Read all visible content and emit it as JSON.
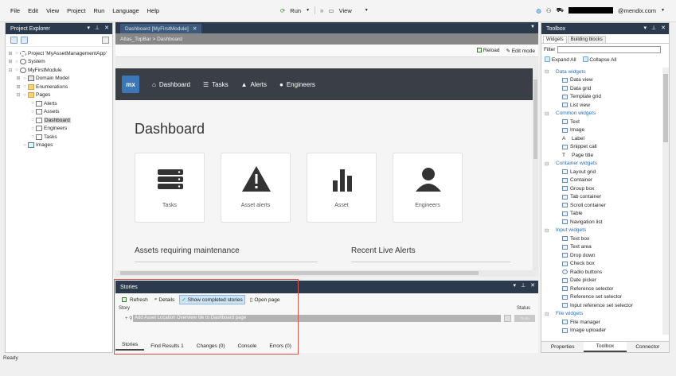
{
  "menubar": {
    "items": [
      "File",
      "Edit",
      "View",
      "Project",
      "Run",
      "Language",
      "Help"
    ],
    "run_label": "Run",
    "view_label": "View",
    "user_suffix": "@mendix.com"
  },
  "explorer": {
    "title": "Project Explorer",
    "tree": [
      {
        "label": "Project 'MyAssetManagementApp'",
        "level": 0,
        "icon": "gear-icon"
      },
      {
        "label": "System",
        "level": 0,
        "icon": "globe-icon"
      },
      {
        "label": "MyFirstModule",
        "level": 0,
        "icon": "globe-icon"
      },
      {
        "label": "Domain Model",
        "level": 1,
        "icon": "domain-model-icon"
      },
      {
        "label": "Enumerations",
        "level": 1,
        "icon": "folder-icon"
      },
      {
        "label": "Pages",
        "level": 1,
        "icon": "folder-icon"
      },
      {
        "label": "Alerts",
        "level": 2,
        "icon": "page-icon"
      },
      {
        "label": "Assets",
        "level": 2,
        "icon": "page-icon"
      },
      {
        "label": "Dashboard",
        "level": 2,
        "icon": "page-icon",
        "selected": true
      },
      {
        "label": "Engineers",
        "level": 2,
        "icon": "page-icon"
      },
      {
        "label": "Tasks",
        "level": 2,
        "icon": "page-icon"
      },
      {
        "label": "Images",
        "level": 1,
        "icon": "image-icon"
      }
    ]
  },
  "editor": {
    "tab_label": "Dashboard [MyFirstModule]",
    "breadcrumb": "Atlas_TopBar > Dashboard",
    "reload_label": "Reload",
    "edit_mode_label": "Edit mode",
    "logo": "mx",
    "nav": [
      "Dashboard",
      "Tasks",
      "Alerts",
      "Engineers"
    ],
    "page_title": "Dashboard",
    "tiles": [
      "Tasks",
      "Asset alerts",
      "Asset",
      "Engineers"
    ],
    "section_left": "Assets requiring maintenance",
    "section_right": "Recent Live Alerts"
  },
  "stories": {
    "title": "Stories",
    "toolbar": {
      "refresh": "Refresh",
      "details": "Details",
      "show_completed": "Show completed stories",
      "open_page": "Open page"
    },
    "col_story": "Story",
    "col_status": "Status",
    "rows": [
      {
        "text": "Add Asset Location Overview tile to Dashboard page",
        "status": "To-do"
      }
    ],
    "tabs": [
      "Stories",
      "Find Results 1",
      "Changes (0)",
      "Console",
      "Errors (0)"
    ]
  },
  "toolbox": {
    "title": "Toolbox",
    "tabs": [
      "Widgets",
      "Building blocks"
    ],
    "filter_label": "Filter",
    "filter_value": "",
    "expand_all": "Expand All",
    "collapse_all": "Collapse All",
    "categories": [
      {
        "name": "Data widgets",
        "items": [
          "Data view",
          "Data grid",
          "Template grid",
          "List view"
        ]
      },
      {
        "name": "Common widgets",
        "items": [
          "Text",
          "Image",
          "Label",
          "Snippet call",
          "Page title"
        ]
      },
      {
        "name": "Container widgets",
        "items": [
          "Layout grid",
          "Container",
          "Group box",
          "Tab container",
          "Scroll container",
          "Table",
          "Navigation list"
        ]
      },
      {
        "name": "Input widgets",
        "items": [
          "Text box",
          "Text area",
          "Drop down",
          "Check box",
          "Radio buttons",
          "Date picker",
          "Reference selector",
          "Reference set selector",
          "Input reference set selector"
        ]
      },
      {
        "name": "File widgets",
        "items": [
          "File manager",
          "Image uploader"
        ]
      }
    ],
    "bottom_tabs": [
      "Properties",
      "Toolbox",
      "Connector"
    ]
  },
  "status": "Ready"
}
